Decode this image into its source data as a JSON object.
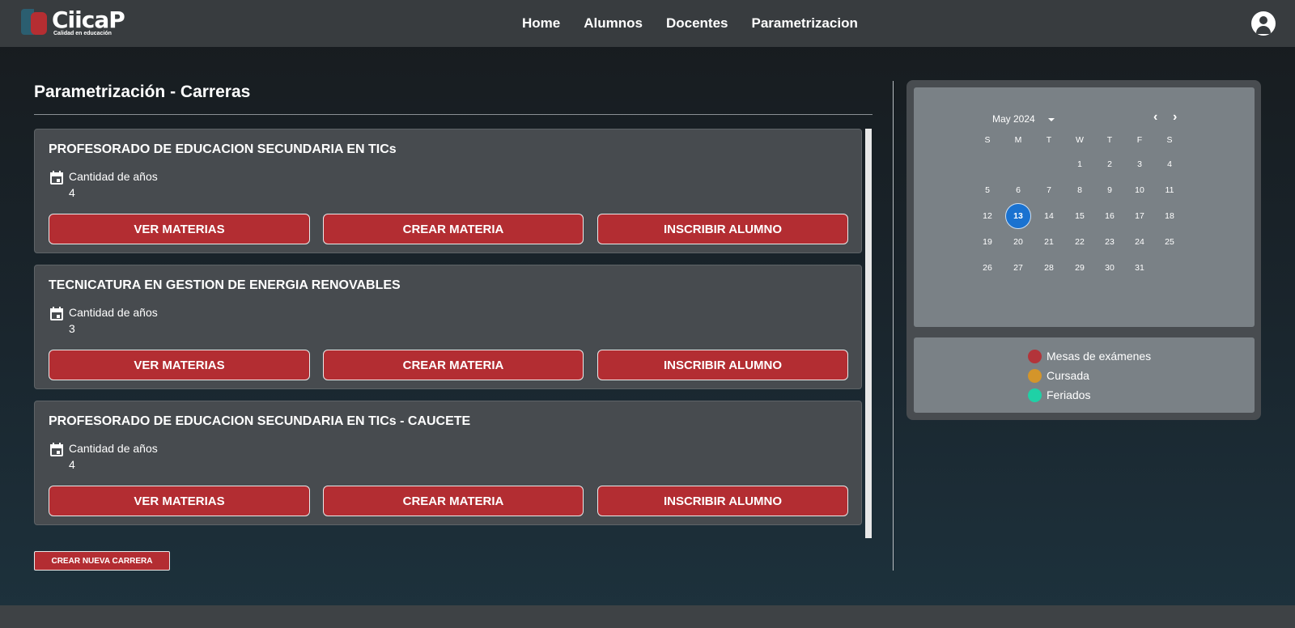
{
  "brand": {
    "name": "CiicaP",
    "tagline": "Calidad en educación"
  },
  "nav": {
    "items": [
      "Home",
      "Alumnos",
      "Docentes",
      "Parametrizacion"
    ]
  },
  "page": {
    "title": "Parametrización - Carreras"
  },
  "careers": [
    {
      "title": "PROFESORADO DE EDUCACION SECUNDARIA EN TICs",
      "meta_label": "Cantidad de años",
      "meta_value": "4",
      "buttons": [
        "VER MATERIAS",
        "CREAR MATERIA",
        "INSCRIBIR ALUMNO"
      ]
    },
    {
      "title": "TECNICATURA EN GESTION DE ENERGIA RENOVABLES",
      "meta_label": "Cantidad de años",
      "meta_value": "3",
      "buttons": [
        "VER MATERIAS",
        "CREAR MATERIA",
        "INSCRIBIR ALUMNO"
      ]
    },
    {
      "title": "PROFESORADO DE EDUCACION SECUNDARIA EN TICs - CAUCETE",
      "meta_label": "Cantidad de años",
      "meta_value": "4",
      "buttons": [
        "VER MATERIAS",
        "CREAR MATERIA",
        "INSCRIBIR ALUMNO"
      ]
    }
  ],
  "new_career_button": "CREAR NUEVA CARRERA",
  "calendar": {
    "month_label": "May 2024",
    "weekdays": [
      "S",
      "M",
      "T",
      "W",
      "T",
      "F",
      "S"
    ],
    "first_weekday_index": 3,
    "days_in_month": 31,
    "today": 13
  },
  "legend": {
    "items": [
      {
        "label": "Mesas de exámenes",
        "color": "#b3343a"
      },
      {
        "label": "Cursada",
        "color": "#d4952a"
      },
      {
        "label": "Feriados",
        "color": "#1fd1a6"
      }
    ]
  },
  "colors": {
    "accent": "#b32d32",
    "today": "#1a72d0"
  }
}
